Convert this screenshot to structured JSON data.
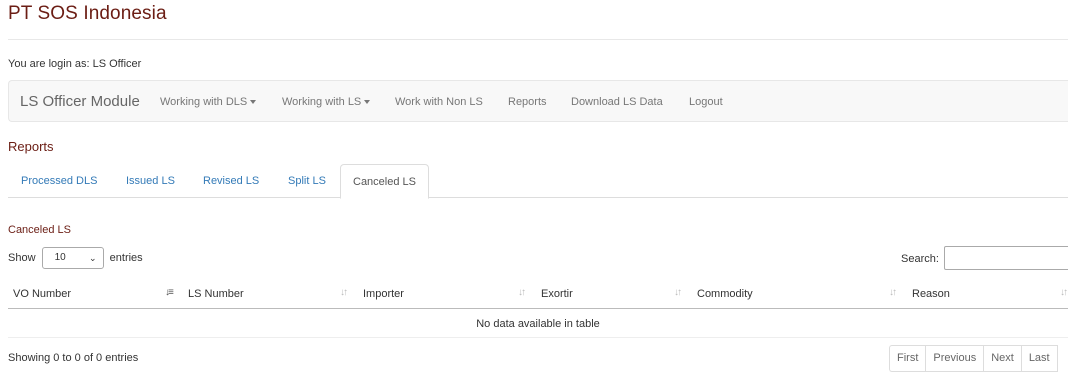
{
  "company_name": "PT SOS Indonesia",
  "login_text": "You are login as: LS Officer",
  "navbar": {
    "brand": "LS Officer Module",
    "items": [
      {
        "label": "Working with DLS",
        "dropdown": true
      },
      {
        "label": "Working with LS",
        "dropdown": true
      },
      {
        "label": "Work with Non LS",
        "dropdown": false
      },
      {
        "label": "Reports",
        "dropdown": false
      },
      {
        "label": "Download LS Data",
        "dropdown": false
      },
      {
        "label": "Logout",
        "dropdown": false
      }
    ]
  },
  "page_heading": "Reports",
  "tabs": [
    {
      "label": "Processed DLS",
      "active": false
    },
    {
      "label": "Issued LS",
      "active": false
    },
    {
      "label": "Revised LS",
      "active": false
    },
    {
      "label": "Split LS",
      "active": false
    },
    {
      "label": "Canceled LS",
      "active": true
    }
  ],
  "table_section": {
    "title": "Canceled LS",
    "show_label": "Show",
    "entries_value": "10",
    "entries_label": "entries",
    "search_label": "Search:",
    "search_value": "",
    "columns": [
      "VO Number",
      "LS Number",
      "Importer",
      "Exortir",
      "Commodity",
      "Reason"
    ],
    "sorted_column": "VO Number",
    "empty_message": "No data available in table",
    "info": "Showing 0 to 0 of 0 entries",
    "pagination": [
      "First",
      "Previous",
      "Next",
      "Last"
    ]
  },
  "colors": {
    "brand_red": "#6b1d14",
    "link_blue": "#337ab7",
    "navbar_bg": "#f8f8f8"
  }
}
